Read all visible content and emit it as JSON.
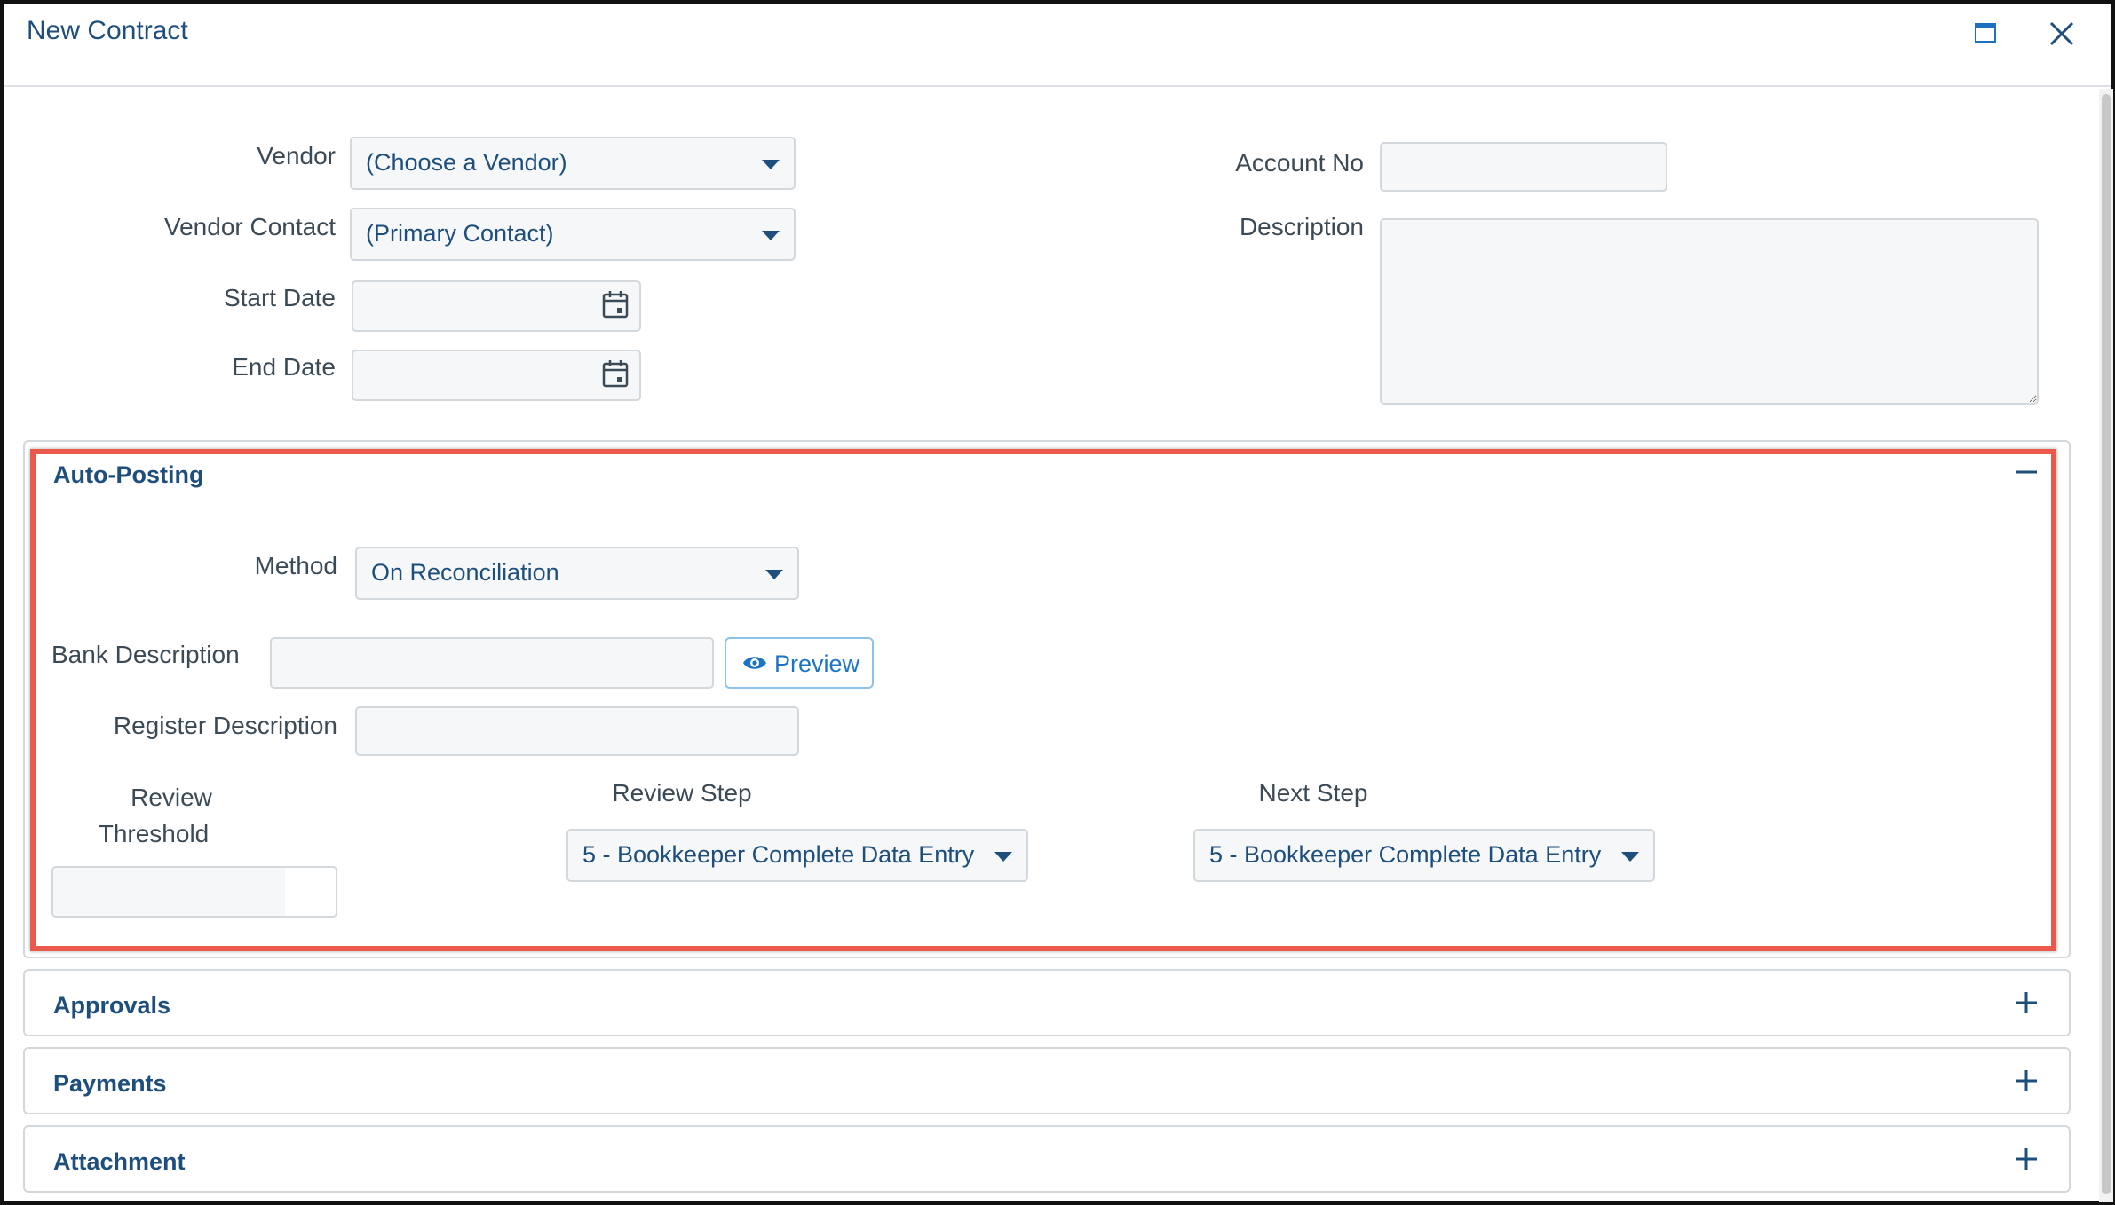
{
  "window": {
    "title": "New Contract"
  },
  "form": {
    "vendor": {
      "label": "Vendor",
      "value": "(Choose a Vendor)"
    },
    "vendor_contact": {
      "label": "Vendor Contact",
      "value": "(Primary Contact)"
    },
    "start_date": {
      "label": "Start Date",
      "value": ""
    },
    "end_date": {
      "label": "End Date",
      "value": ""
    },
    "account_no": {
      "label": "Account No",
      "value": ""
    },
    "description": {
      "label": "Description",
      "value": ""
    }
  },
  "auto_posting": {
    "title": "Auto-Posting",
    "method": {
      "label": "Method",
      "value": "On Reconciliation"
    },
    "bank_description": {
      "label": "Bank Description",
      "value": ""
    },
    "preview_label": "Preview",
    "register_description": {
      "label": "Register Description",
      "value": ""
    },
    "review_threshold": {
      "label_line1": "Review",
      "label_line2": "Threshold",
      "value": ""
    },
    "review_step": {
      "label": "Review Step",
      "value": "5 - Bookkeeper Complete Data Entry"
    },
    "next_step": {
      "label": "Next Step",
      "value": "5 - Bookkeeper Complete Data Entry"
    }
  },
  "sections": [
    {
      "title": "Approvals"
    },
    {
      "title": "Payments"
    },
    {
      "title": "Attachment"
    }
  ],
  "icons": {
    "maximize": "maximize-icon",
    "close": "close-icon",
    "calendar": "calendar-icon",
    "collapse": "minus-icon",
    "expand": "plus-icon",
    "eye": "eye-icon"
  },
  "colors": {
    "accent": "#1d4e7c",
    "link": "#1d74c4",
    "highlight": "#ea5a4c"
  }
}
